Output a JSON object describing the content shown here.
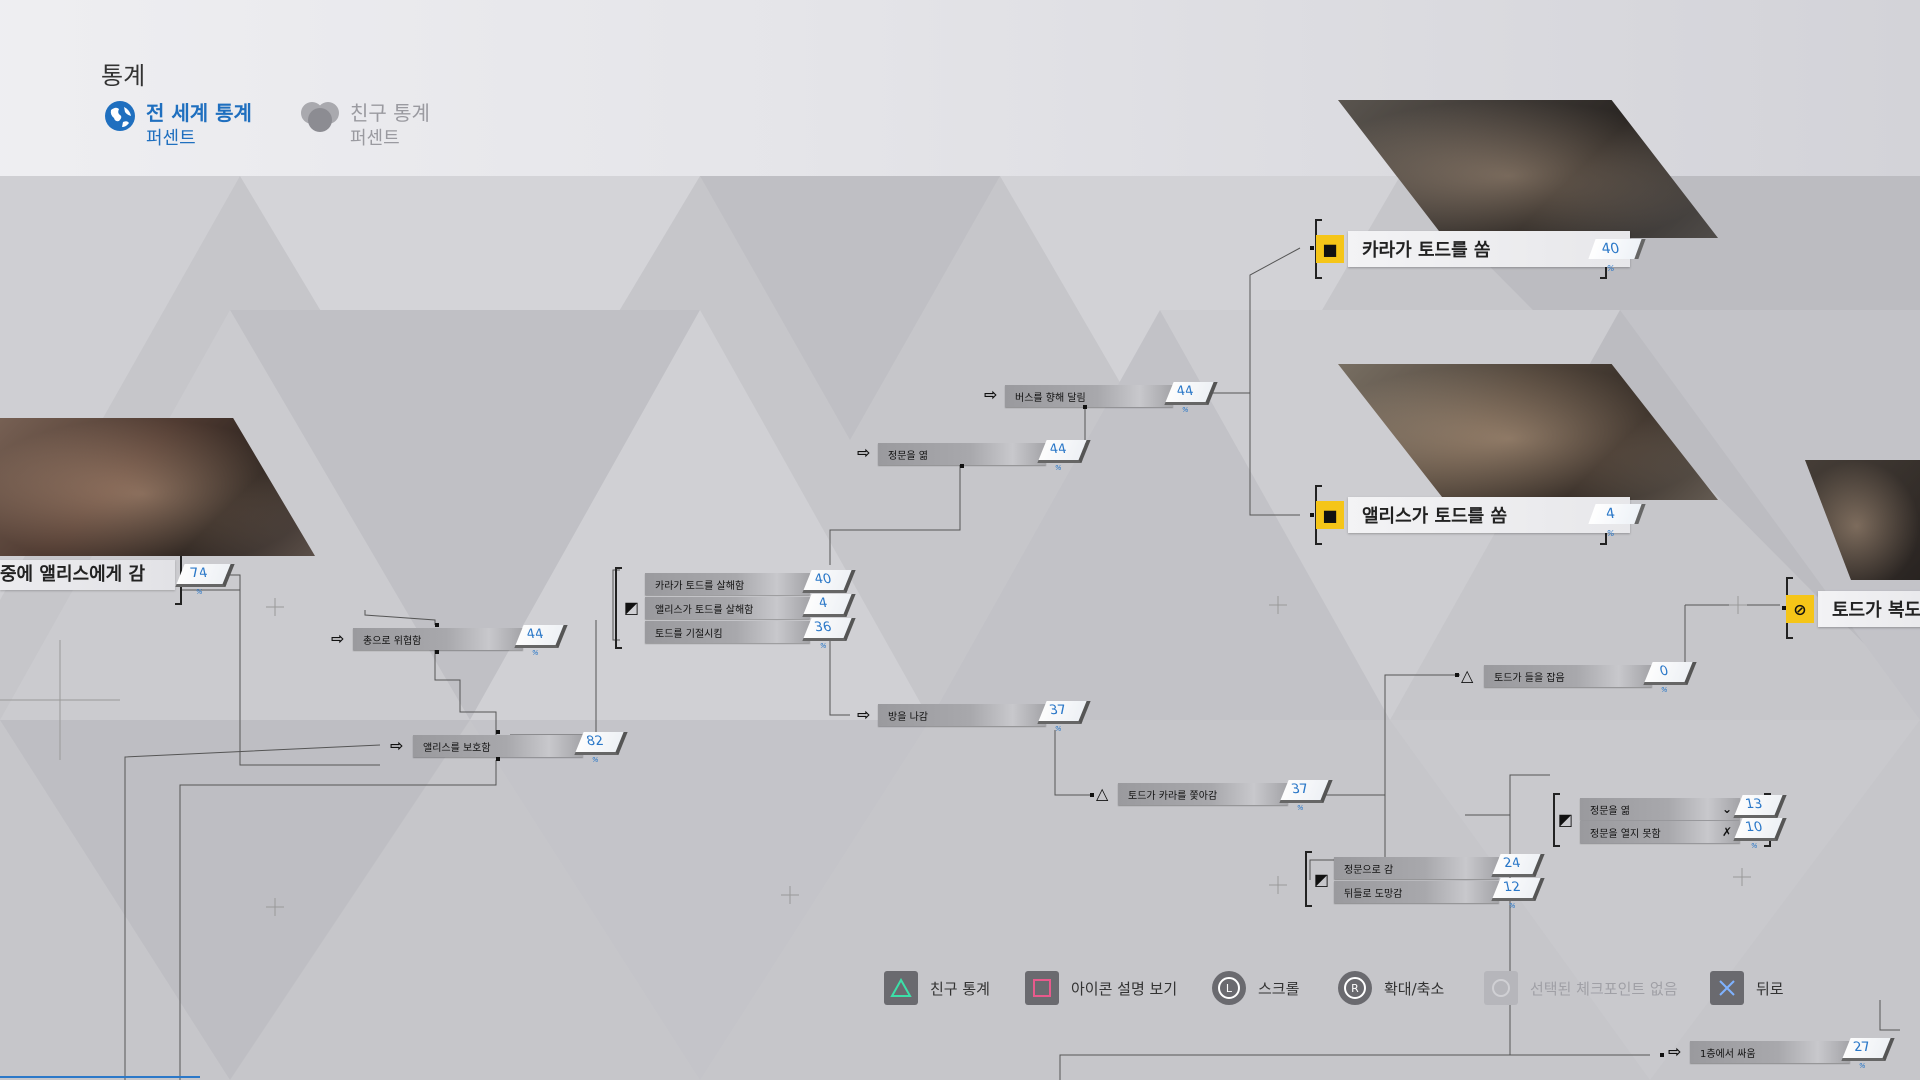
{
  "header": {
    "title": "통계",
    "tabs": [
      {
        "label": "전 세계 통계",
        "sub": "퍼센트",
        "active": true
      },
      {
        "label": "친구 통계",
        "sub": "퍼센트",
        "active": false
      }
    ]
  },
  "colors": {
    "accent": "#2b78c8",
    "badge": "#f5c518",
    "active_tab": "#1f6fbf"
  },
  "outcomes": {
    "kara_shoots": {
      "label": "카라가 토드를 쏨",
      "pct": "40"
    },
    "alice_shoots": {
      "label": "앨리스가 토드를 쏨",
      "pct": "4"
    },
    "todd_hallway": {
      "label": "토드가 복도에"
    },
    "left_alice": {
      "label": "중에 앨리스에게 감",
      "pct": "74"
    }
  },
  "nodes": {
    "run_bus": {
      "label": "버스를 향해 달림",
      "pct": "44"
    },
    "open_gate": {
      "label": "정문을 엶",
      "pct": "44"
    },
    "kara_kills": {
      "label": "카라가 토드를 살해함",
      "pct": "40"
    },
    "alice_kills": {
      "label": "앨리스가 토드를 살해함",
      "pct": "4"
    },
    "todd_faint": {
      "label": "토드를 기절시킴",
      "pct": "36"
    },
    "threat_gun": {
      "label": "총으로 위협함",
      "pct": "44"
    },
    "protect_alice": {
      "label": "앨리스를 보호함",
      "pct": "82"
    },
    "leave_room": {
      "label": "방을 나감",
      "pct": "37"
    },
    "todd_grabs": {
      "label": "토드가 들을 잡음",
      "pct": "0"
    },
    "todd_chases": {
      "label": "토드가 카라를 쫓아감",
      "pct": "37"
    },
    "to_gate": {
      "label": "정문으로 감",
      "pct": "24"
    },
    "back_escape": {
      "label": "뒤들로 도망감",
      "pct": "12"
    },
    "gate_open": {
      "label": "정문을 엶",
      "pct": "13"
    },
    "gate_fail": {
      "label": "정문을 열지 못함",
      "pct": "10"
    },
    "fight_floor1": {
      "label": "1층에서 싸움",
      "pct": "27"
    }
  },
  "pct_unit": "%",
  "footer": [
    {
      "label": "친구 통계",
      "icon": "triangle-icon",
      "enabled": true
    },
    {
      "label": "아이콘 설명 보기",
      "icon": "square-icon",
      "enabled": true
    },
    {
      "label": "스크롤",
      "icon": "l-stick-icon",
      "enabled": true
    },
    {
      "label": "확대/축소",
      "icon": "r-stick-icon",
      "enabled": true
    },
    {
      "label": "선택된 체크포인트 없음",
      "icon": "circle-icon",
      "enabled": false
    },
    {
      "label": "뒤로",
      "icon": "cross-icon",
      "enabled": true
    }
  ]
}
